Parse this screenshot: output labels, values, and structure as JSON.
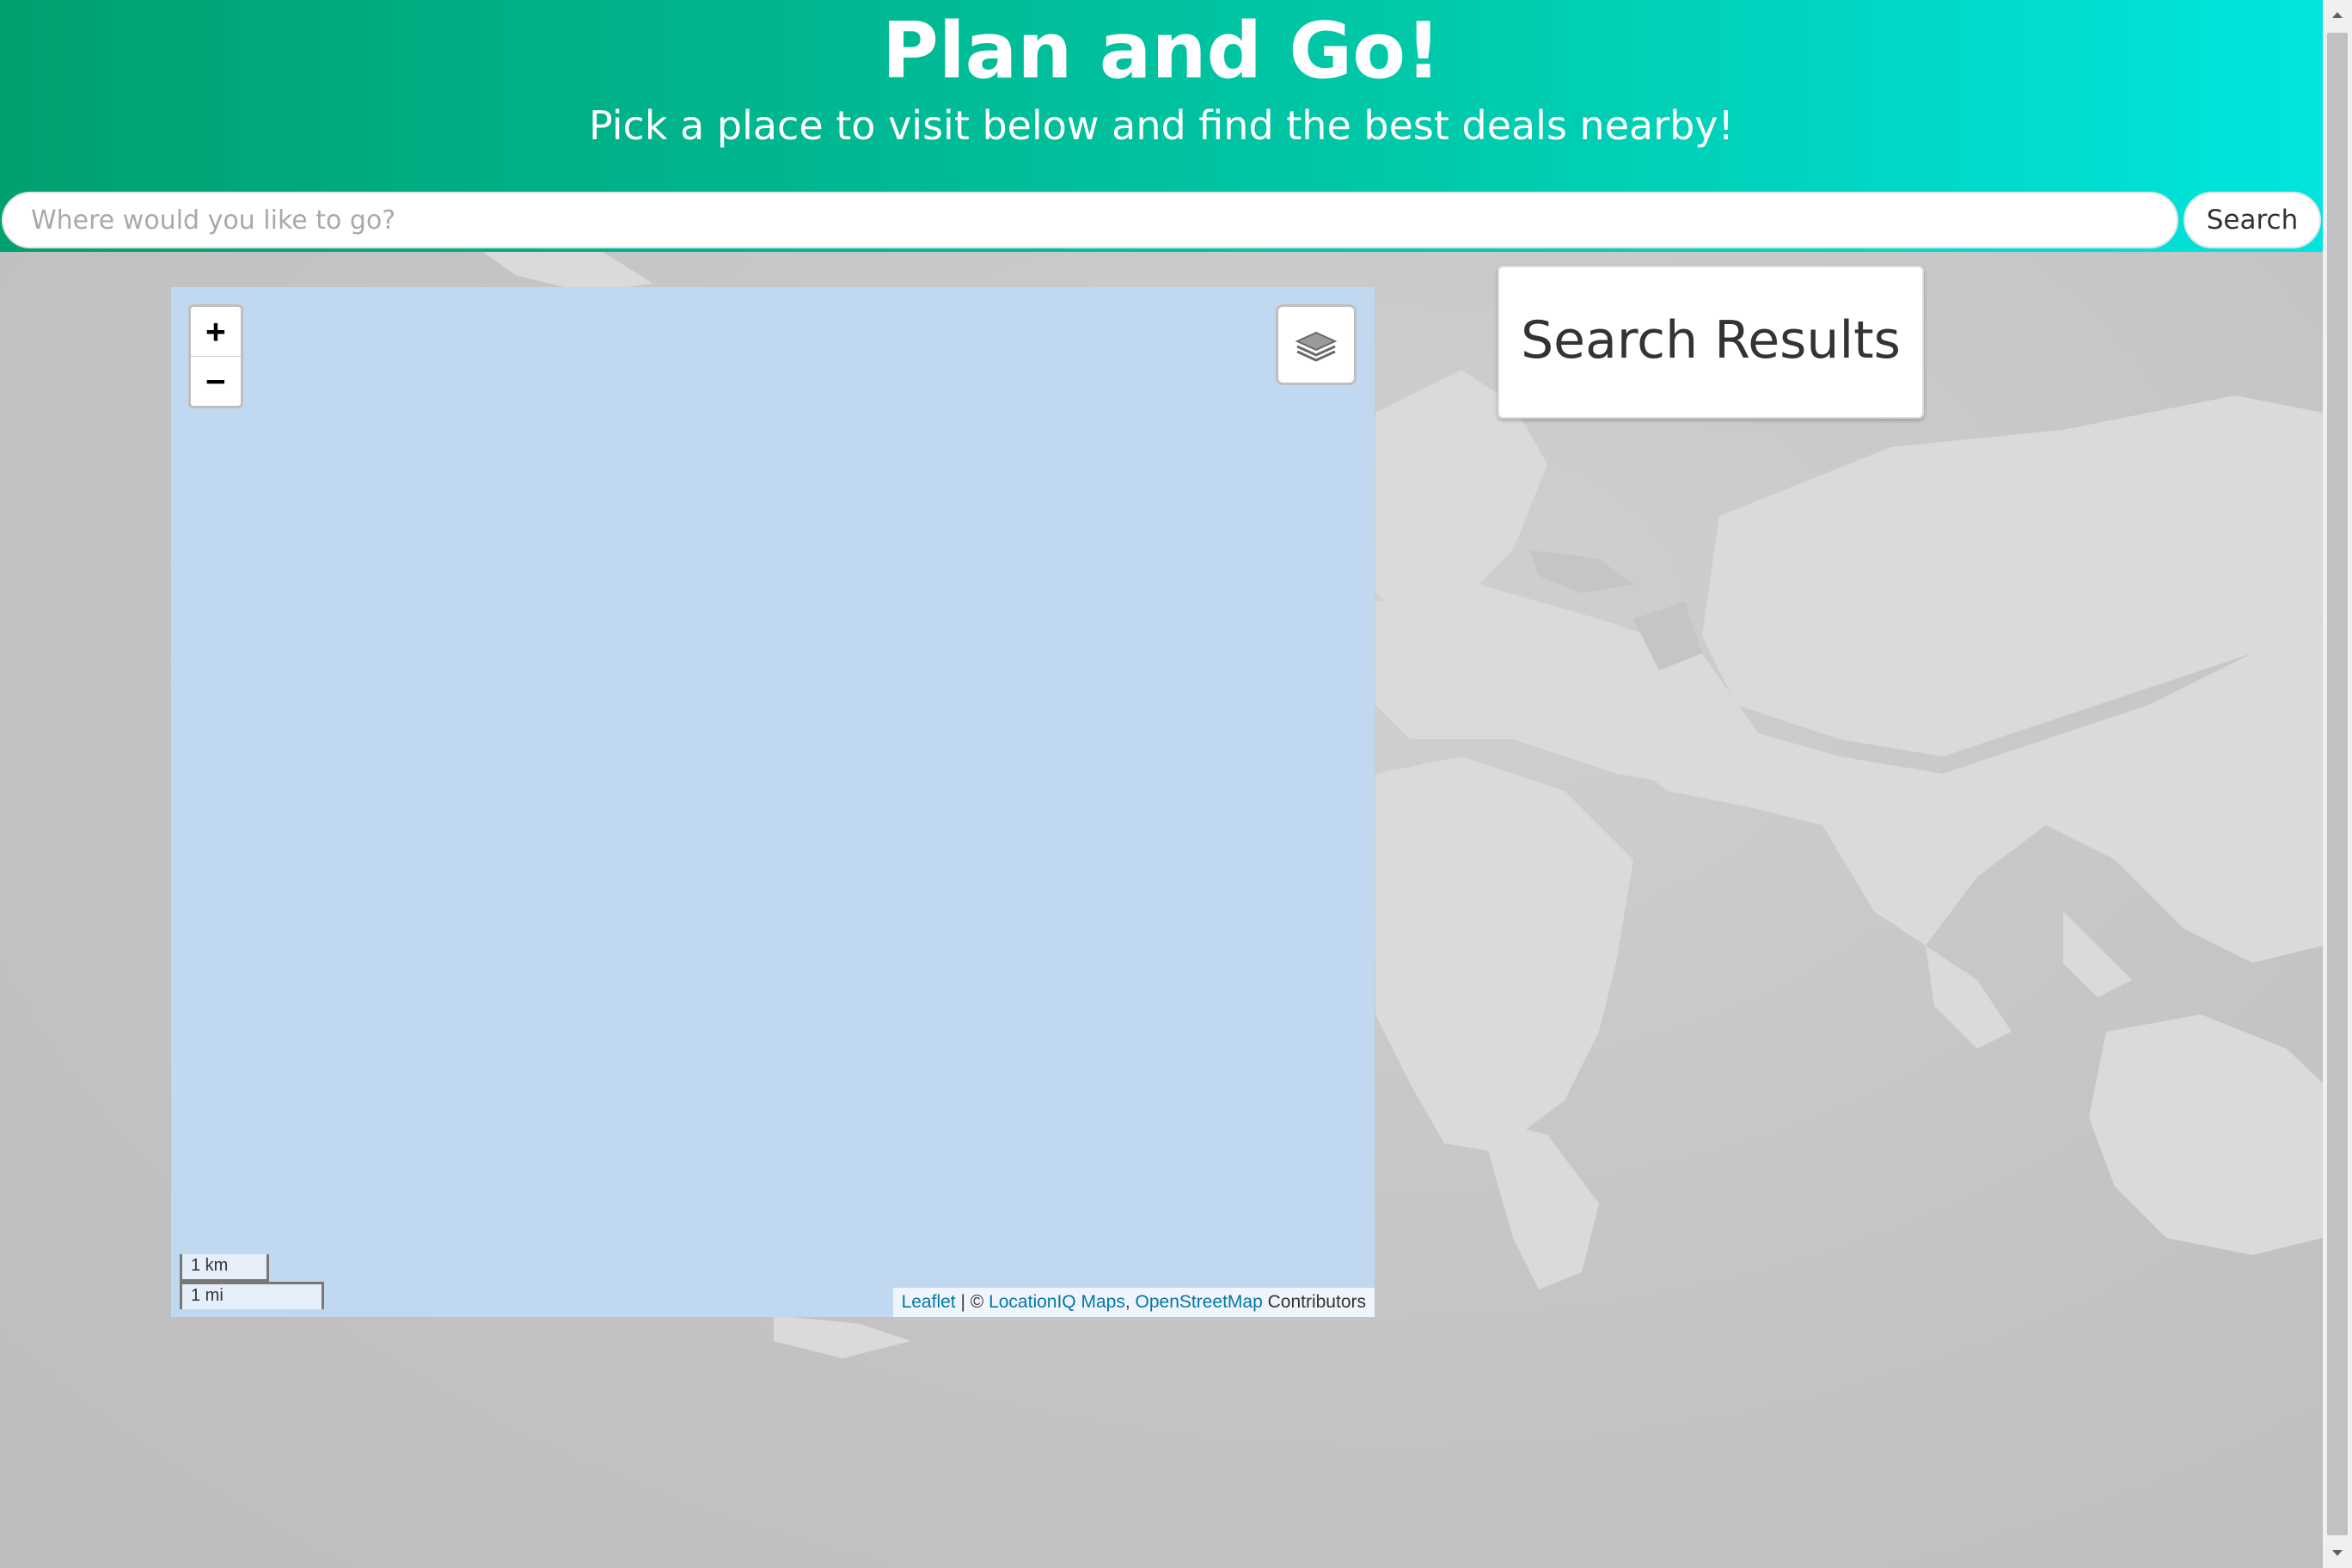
{
  "header": {
    "title": "Plan and Go!",
    "subtitle": "Pick a place to visit below and find the best deals nearby!"
  },
  "search": {
    "placeholder": "Where would you like to go?",
    "value": "",
    "button_label": "Search"
  },
  "map": {
    "zoom_in_label": "+",
    "zoom_out_label": "−",
    "layers_icon": "layers-icon",
    "scale_km": "1 km",
    "scale_mi": "1 mi",
    "attribution": {
      "leaflet": "Leaflet",
      "separator": " | © ",
      "locationiq": "LocationIQ Maps",
      "comma": ", ",
      "osm": "OpenStreetMap",
      "contributors": " Contributors"
    }
  },
  "results": {
    "title": "Search Results"
  },
  "colors": {
    "header_gradient_start": "#00a070",
    "header_gradient_end": "#00e5de",
    "map_water": "#c0d8f0",
    "link": "#0078a8"
  }
}
